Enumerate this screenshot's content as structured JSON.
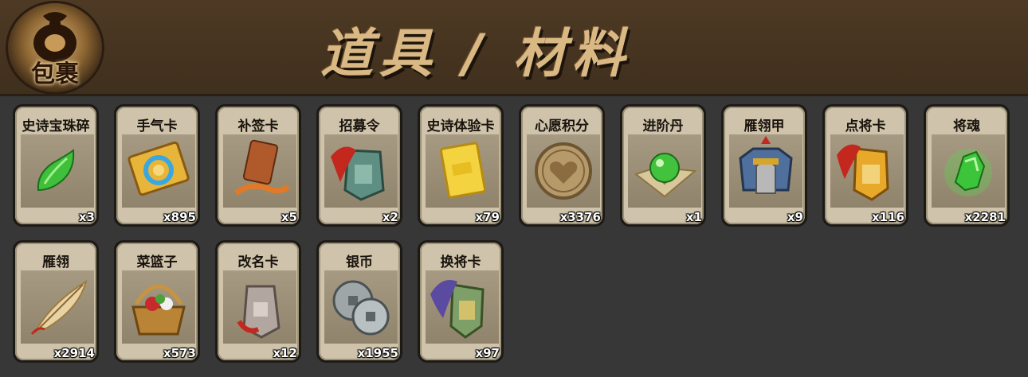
{
  "header": {
    "bag_label": "包裹",
    "title": "道具 / 材料"
  },
  "items": [
    {
      "name": "史诗宝珠碎",
      "count": "x3",
      "icon": "green-shard-icon"
    },
    {
      "name": "手气卡",
      "count": "x895",
      "icon": "luck-card-icon"
    },
    {
      "name": "补签卡",
      "count": "x5",
      "icon": "sign-token-icon"
    },
    {
      "name": "招募令",
      "count": "x2",
      "icon": "recruit-token-icon"
    },
    {
      "name": "史诗体验卡",
      "count": "x79",
      "icon": "gold-card-icon"
    },
    {
      "name": "心愿积分",
      "count": "x3376",
      "icon": "heart-coin-icon"
    },
    {
      "name": "进阶丹",
      "count": "x1",
      "icon": "green-orb-icon"
    },
    {
      "name": "雁翎甲",
      "count": "x9",
      "icon": "armor-icon"
    },
    {
      "name": "点将卡",
      "count": "x116",
      "icon": "general-token-icon"
    },
    {
      "name": "将魂",
      "count": "x2281",
      "icon": "green-crystal-icon"
    },
    {
      "name": "雁翎",
      "count": "x2914",
      "icon": "feather-icon"
    },
    {
      "name": "菜篮子",
      "count": "x573",
      "icon": "basket-icon"
    },
    {
      "name": "改名卡",
      "count": "x12",
      "icon": "rename-token-icon"
    },
    {
      "name": "银币",
      "count": "x1955",
      "icon": "silver-coins-icon"
    },
    {
      "name": "换将卡",
      "count": "x97",
      "icon": "swap-token-icon"
    }
  ]
}
